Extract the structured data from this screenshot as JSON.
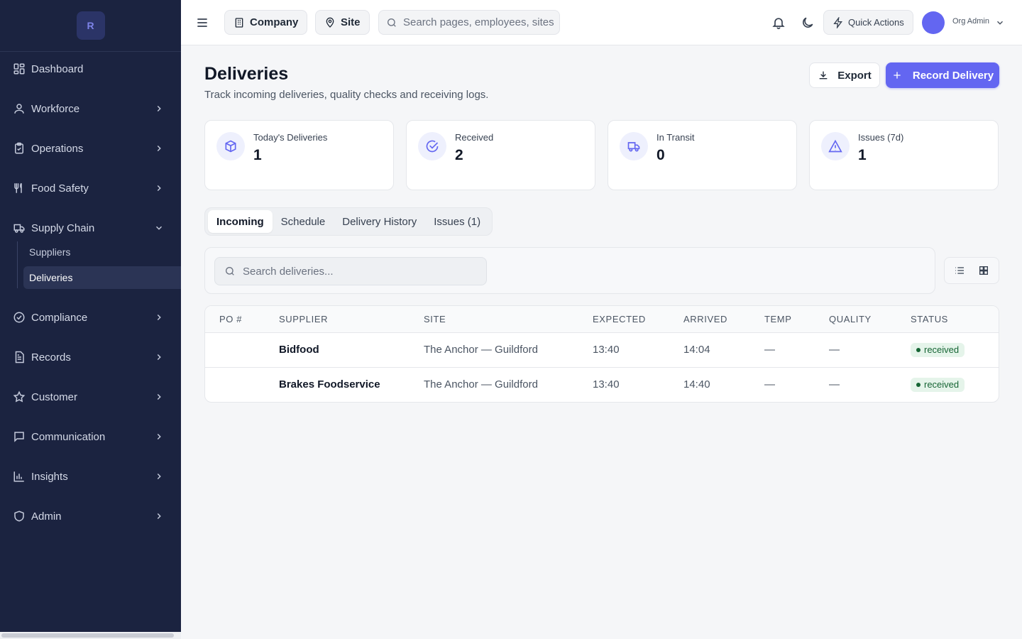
{
  "sidebar": {
    "logo": "R",
    "items": [
      {
        "label": "Dashboard",
        "icon": "dashboard-icon"
      },
      {
        "label": "Workforce",
        "icon": "users-icon"
      },
      {
        "label": "Operations",
        "icon": "clipboard-icon"
      },
      {
        "label": "Food Safety",
        "icon": "utensils-icon"
      },
      {
        "label": "Supply Chain",
        "icon": "truck-icon",
        "expanded": true
      },
      {
        "label": "Compliance",
        "icon": "check-circle-icon"
      },
      {
        "label": "Records",
        "icon": "file-icon"
      },
      {
        "label": "Customer",
        "icon": "star-icon"
      },
      {
        "label": "Communication",
        "icon": "message-icon"
      },
      {
        "label": "Insights",
        "icon": "bar-chart-icon"
      },
      {
        "label": "Admin",
        "icon": "shield-icon"
      }
    ],
    "sub_items": [
      {
        "label": "Suppliers",
        "active": false
      },
      {
        "label": "Deliveries",
        "active": true
      }
    ]
  },
  "topbar": {
    "company_label": "Company",
    "site_label": "Site",
    "search_placeholder": "Search pages, employees, sites",
    "quick_actions_label": "Quick Actions",
    "user_label": "Org Admin"
  },
  "page": {
    "title": "Deliveries",
    "subtitle": "Track incoming deliveries, quality checks and receiving logs.",
    "export_label": "Export",
    "record_label": "Record Delivery"
  },
  "stats": [
    {
      "label": "Today's Deliveries",
      "value": "1",
      "icon": "package-icon"
    },
    {
      "label": "Received",
      "value": "2",
      "icon": "check-circle-icon"
    },
    {
      "label": "In Transit",
      "value": "0",
      "icon": "truck-icon"
    },
    {
      "label": "Issues (7d)",
      "value": "1",
      "icon": "warning-icon"
    }
  ],
  "tabs": [
    "Incoming",
    "Schedule",
    "Delivery History",
    "Issues (1)"
  ],
  "filter": {
    "search_placeholder": "Search deliveries..."
  },
  "table": {
    "headers": [
      "PO #",
      "SUPPLIER",
      "SITE",
      "EXPECTED",
      "ARRIVED",
      "TEMP",
      "QUALITY",
      "STATUS"
    ],
    "rows": [
      {
        "po": "",
        "supplier": "Bidfood",
        "site": "The Anchor — Guildford",
        "expected": "13:40",
        "arrived": "14:04",
        "temp": "—",
        "quality": "—",
        "status": "received"
      },
      {
        "po": "",
        "supplier": "Brakes Foodservice",
        "site": "The Anchor — Guildford",
        "expected": "13:40",
        "arrived": "14:40",
        "temp": "—",
        "quality": "—",
        "status": "received"
      }
    ]
  },
  "colors": {
    "accent": "#6366f1",
    "sidebar_bg": "#1b2340",
    "success": "#166534"
  }
}
